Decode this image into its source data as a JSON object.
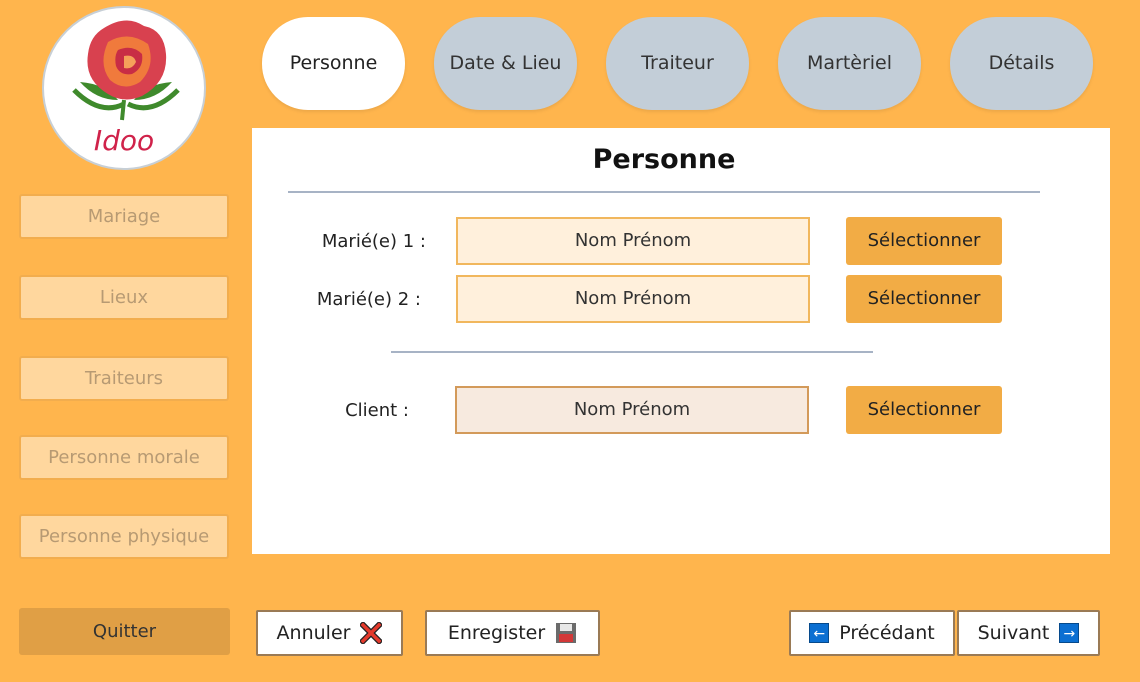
{
  "logo": {
    "text": "Idoo"
  },
  "sidebar": {
    "items": [
      {
        "label": "Mariage"
      },
      {
        "label": "Lieux"
      },
      {
        "label": "Traiteurs"
      },
      {
        "label": "Personne morale"
      },
      {
        "label": "Personne physique"
      }
    ],
    "quit_label": "Quitter"
  },
  "tabs": [
    {
      "label": "Personne",
      "active": true
    },
    {
      "label": "Date & Lieu",
      "active": false
    },
    {
      "label": "Traiteur",
      "active": false
    },
    {
      "label": "Martèriel",
      "active": false
    },
    {
      "label": "Détails",
      "active": false
    }
  ],
  "panel": {
    "title": "Personne",
    "rows": [
      {
        "label": "Marié(e) 1 :",
        "value": "Nom Prénom",
        "button": "Sélectionner"
      },
      {
        "label": "Marié(e) 2 :",
        "value": "Nom Prénom",
        "button": "Sélectionner"
      },
      {
        "label": "Client :",
        "value": "Nom Prénom",
        "button": "Sélectionner"
      }
    ]
  },
  "footer": {
    "cancel_label": "Annuler",
    "save_label": "Enregister",
    "prev_label": "Précédant",
    "next_label": "Suivant"
  },
  "colors": {
    "background": "#ffb54d",
    "accent_button": "#f2ac45",
    "tab_inactive": "#c3ced8"
  }
}
